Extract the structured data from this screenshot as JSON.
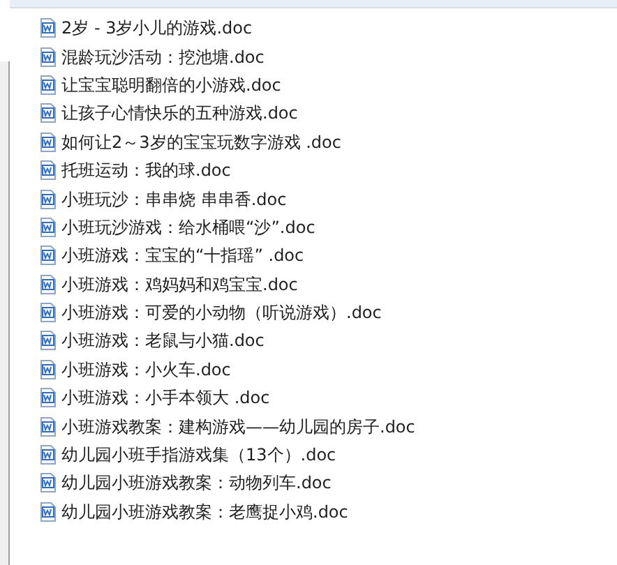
{
  "files": [
    {
      "name": "2岁 - 3岁小儿的游戏.doc"
    },
    {
      "name": "混龄玩沙活动：挖池塘.doc"
    },
    {
      "name": "让宝宝聪明翻倍的小游戏.doc"
    },
    {
      "name": "让孩子心情快乐的五种游戏.doc"
    },
    {
      "name": "如何让2～3岁的宝宝玩数字游戏 .doc"
    },
    {
      "name": "托班运动：我的球.doc"
    },
    {
      "name": "小班玩沙：串串烧 串串香.doc"
    },
    {
      "name": "小班玩沙游戏：给水桶喂“沙”.doc"
    },
    {
      "name": "小班游戏：宝宝的“十指瑶” .doc"
    },
    {
      "name": "小班游戏：鸡妈妈和鸡宝宝.doc"
    },
    {
      "name": "小班游戏：可爱的小动物（听说游戏）.doc"
    },
    {
      "name": "小班游戏：老鼠与小猫.doc"
    },
    {
      "name": "小班游戏：小火车.doc"
    },
    {
      "name": "小班游戏：小手本领大 .doc"
    },
    {
      "name": "小班游戏教案：建构游戏——幼儿园的房子.doc"
    },
    {
      "name": "幼儿园小班手指游戏集（13个）.doc"
    },
    {
      "name": "幼儿园小班游戏教案：动物列车.doc"
    },
    {
      "name": "幼儿园小班游戏教案：老鹰捉小鸡.doc"
    }
  ]
}
